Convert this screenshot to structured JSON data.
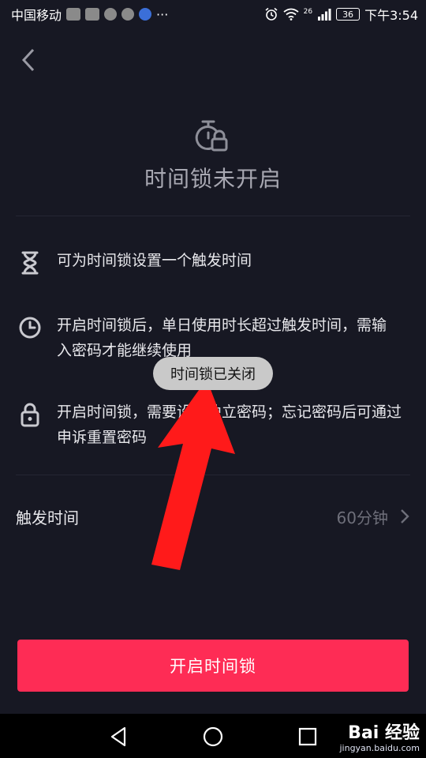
{
  "status_bar": {
    "carrier": "中国移动",
    "more": "···",
    "signal_label": "26",
    "battery": "36",
    "time": "下午3:54"
  },
  "hero": {
    "title": "时间锁未开启"
  },
  "features": [
    {
      "icon": "hourglass-icon",
      "text": "可为时间锁设置一个触发时间"
    },
    {
      "icon": "clock-icon",
      "text": "开启时间锁后，单日使用时长超过触发时间，需输入密码才能继续使用"
    },
    {
      "icon": "lock-icon",
      "text": "开启时间锁，需要设置独立密码；忘记密码后可通过申诉重置密码"
    }
  ],
  "trigger": {
    "label": "触发时间",
    "value": "60分钟"
  },
  "primary_button": "开启时间锁",
  "toast": "时间锁已关闭",
  "watermark": {
    "brand": "Bai 经验",
    "sub": "jingyan.baidu.com"
  },
  "colors": {
    "background": "#171823",
    "accent": "#fe2c55",
    "arrow": "#ff1a1a"
  }
}
